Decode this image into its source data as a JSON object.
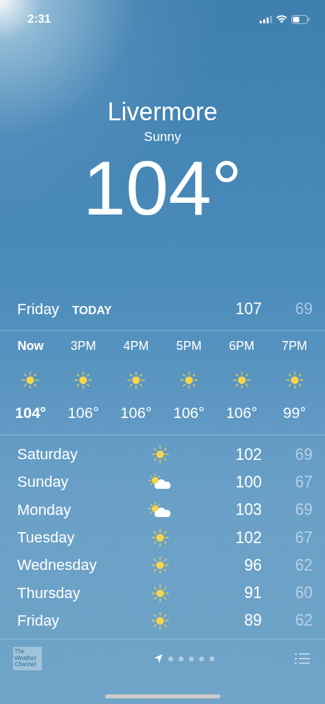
{
  "status_bar": {
    "time": "2:31"
  },
  "location": {
    "city": "Livermore",
    "condition": "Sunny",
    "temperature": "104°"
  },
  "today": {
    "day": "Friday",
    "label": "TODAY",
    "high": "107",
    "low": "69"
  },
  "hourly": [
    {
      "time": "Now",
      "kind": "sun",
      "temp": "104°",
      "current": true
    },
    {
      "time": "3PM",
      "kind": "sun",
      "temp": "106°",
      "current": false
    },
    {
      "time": "4PM",
      "kind": "sun",
      "temp": "106°",
      "current": false
    },
    {
      "time": "5PM",
      "kind": "sun",
      "temp": "106°",
      "current": false
    },
    {
      "time": "6PM",
      "kind": "sun",
      "temp": "106°",
      "current": false
    },
    {
      "time": "7PM",
      "kind": "sun",
      "temp": "99°",
      "current": false
    }
  ],
  "daily": [
    {
      "day": "Saturday",
      "kind": "sun",
      "high": "102",
      "low": "69"
    },
    {
      "day": "Sunday",
      "kind": "cloud",
      "high": "100",
      "low": "67"
    },
    {
      "day": "Monday",
      "kind": "cloud",
      "high": "103",
      "low": "69"
    },
    {
      "day": "Tuesday",
      "kind": "sun",
      "high": "102",
      "low": "67"
    },
    {
      "day": "Wednesday",
      "kind": "sun",
      "high": "96",
      "low": "62"
    },
    {
      "day": "Thursday",
      "kind": "sun",
      "high": "91",
      "low": "60"
    },
    {
      "day": "Friday",
      "kind": "sun",
      "high": "89",
      "low": "62"
    }
  ],
  "footer": {
    "logo": "The Weather Channel",
    "pages": [
      {
        "kind": "location",
        "selected": true
      },
      {
        "kind": "dot",
        "selected": false
      },
      {
        "kind": "dot",
        "selected": false
      },
      {
        "kind": "dot",
        "selected": false
      },
      {
        "kind": "dot",
        "selected": false
      },
      {
        "kind": "dot",
        "selected": false
      }
    ]
  }
}
